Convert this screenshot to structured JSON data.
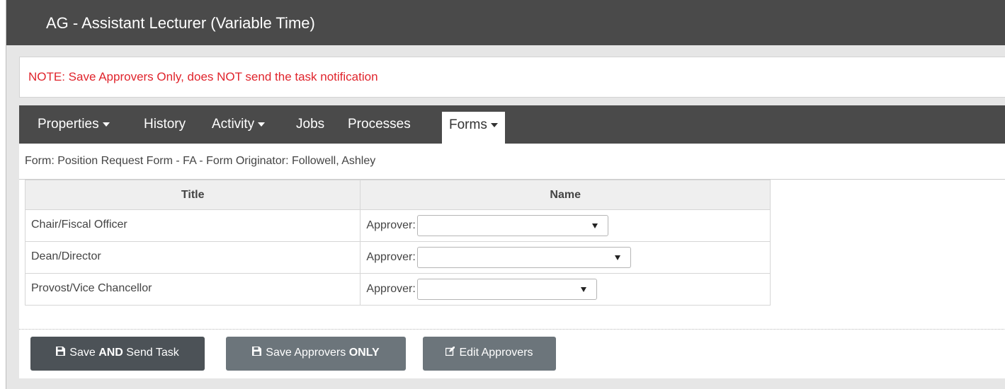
{
  "header": {
    "title": "AG - Assistant Lecturer (Variable Time)"
  },
  "note": {
    "text": "NOTE: Save Approvers Only, does NOT send the task notification",
    "color": "#e0242c"
  },
  "tabs": [
    {
      "label": "Properties",
      "dropdown": true
    },
    {
      "label": "History",
      "dropdown": false
    },
    {
      "label": "Activity",
      "dropdown": true
    },
    {
      "label": "Jobs",
      "dropdown": false
    },
    {
      "label": "Processes",
      "dropdown": false
    },
    {
      "label": "Forms",
      "dropdown": true,
      "active": true
    }
  ],
  "form": {
    "caption": "Form: Position Request Form - FA - Form Originator: Followell, Ashley"
  },
  "table": {
    "headers": {
      "title": "Title",
      "name": "Name"
    },
    "rows": [
      {
        "title": "Chair/Fiscal Officer",
        "approver_label": "Approver:",
        "approver_value": ""
      },
      {
        "title": "Dean/Director",
        "approver_label": "Approver:",
        "approver_value": ""
      },
      {
        "title": "Provost/Vice Chancellor",
        "approver_label": "Approver:",
        "approver_value": ""
      }
    ]
  },
  "buttons": {
    "save_send": {
      "prefix": "Save ",
      "bold": "AND",
      "suffix": " Send Task",
      "icon": "floppy-disk-icon"
    },
    "save_approvers": {
      "prefix": "Save Approvers ",
      "bold": "ONLY",
      "suffix": "",
      "icon": "floppy-disk-icon"
    },
    "edit_approvers": {
      "prefix": "Edit Approvers",
      "bold": "",
      "suffix": "",
      "icon": "edit-icon"
    }
  }
}
